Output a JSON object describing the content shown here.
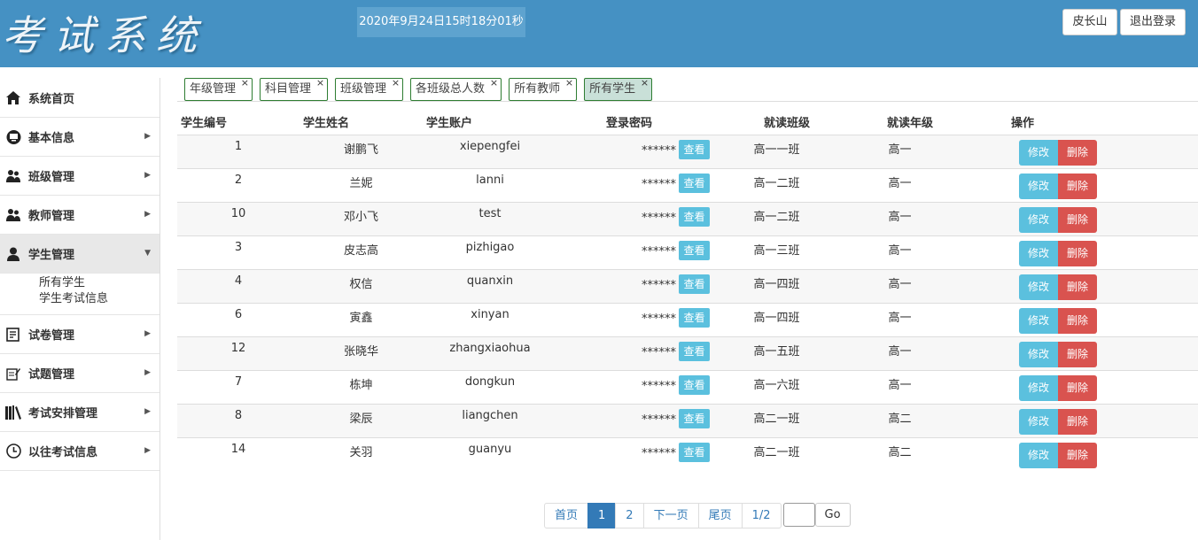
{
  "header": {
    "logo": "考试系统",
    "clock": "2020年9月24日15时18分01秒",
    "user_button": "皮长山",
    "logout_button": "退出登录"
  },
  "sidebar": {
    "items": [
      {
        "label": "系统首页",
        "icon": "home-icon"
      },
      {
        "label": "基本信息",
        "icon": "monitor-icon"
      },
      {
        "label": "班级管理",
        "icon": "users-icon"
      },
      {
        "label": "教师管理",
        "icon": "users-icon"
      },
      {
        "label": "学生管理",
        "icon": "user-icon"
      },
      {
        "label": "试卷管理",
        "icon": "paper-icon"
      },
      {
        "label": "试题管理",
        "icon": "edit-icon"
      },
      {
        "label": "考试安排管理",
        "icon": "books-icon"
      },
      {
        "label": "以往考试信息",
        "icon": "clock-icon"
      }
    ],
    "submenu": [
      "所有学生",
      "学生考试信息"
    ]
  },
  "tabs": [
    {
      "label": "年级管理"
    },
    {
      "label": "科目管理"
    },
    {
      "label": "班级管理"
    },
    {
      "label": "各班级总人数"
    },
    {
      "label": "所有教师"
    },
    {
      "label": "所有学生"
    }
  ],
  "table": {
    "headers": [
      "学生编号",
      "学生姓名",
      "学生账户",
      "登录密码",
      "就读班级",
      "就读年级",
      "操作"
    ],
    "rows": [
      {
        "id": "1",
        "name": "谢鹏飞",
        "account": "xiepengfei",
        "password": "******",
        "class": "高一一班",
        "grade": "高一"
      },
      {
        "id": "2",
        "name": "兰妮",
        "account": "lanni",
        "password": "******",
        "class": "高一二班",
        "grade": "高一"
      },
      {
        "id": "10",
        "name": "邓小飞",
        "account": "test",
        "password": "******",
        "class": "高一二班",
        "grade": "高一"
      },
      {
        "id": "3",
        "name": "皮志高",
        "account": "pizhigao",
        "password": "******",
        "class": "高一三班",
        "grade": "高一"
      },
      {
        "id": "4",
        "name": "权信",
        "account": "quanxin",
        "password": "******",
        "class": "高一四班",
        "grade": "高一"
      },
      {
        "id": "6",
        "name": "寅鑫",
        "account": "xinyan",
        "password": "******",
        "class": "高一四班",
        "grade": "高一"
      },
      {
        "id": "12",
        "name": "张晓华",
        "account": "zhangxiaohua",
        "password": "******",
        "class": "高一五班",
        "grade": "高一"
      },
      {
        "id": "7",
        "name": "栋坤",
        "account": "dongkun",
        "password": "******",
        "class": "高一六班",
        "grade": "高一"
      },
      {
        "id": "8",
        "name": "梁辰",
        "account": "liangchen",
        "password": "******",
        "class": "高二一班",
        "grade": "高二"
      },
      {
        "id": "14",
        "name": "关羽",
        "account": "guanyu",
        "password": "******",
        "class": "高二一班",
        "grade": "高二"
      }
    ],
    "view_label": "查看",
    "edit_label": "修改",
    "delete_label": "删除"
  },
  "pager": {
    "first": "首页",
    "pages": [
      "1",
      "2"
    ],
    "next": "下一页",
    "last": "尾页",
    "info": "1/2",
    "go": "Go"
  },
  "colors": {
    "header": "#4591c3",
    "info": "#5bc0de",
    "danger": "#d9534f",
    "primary": "#337ab7"
  }
}
